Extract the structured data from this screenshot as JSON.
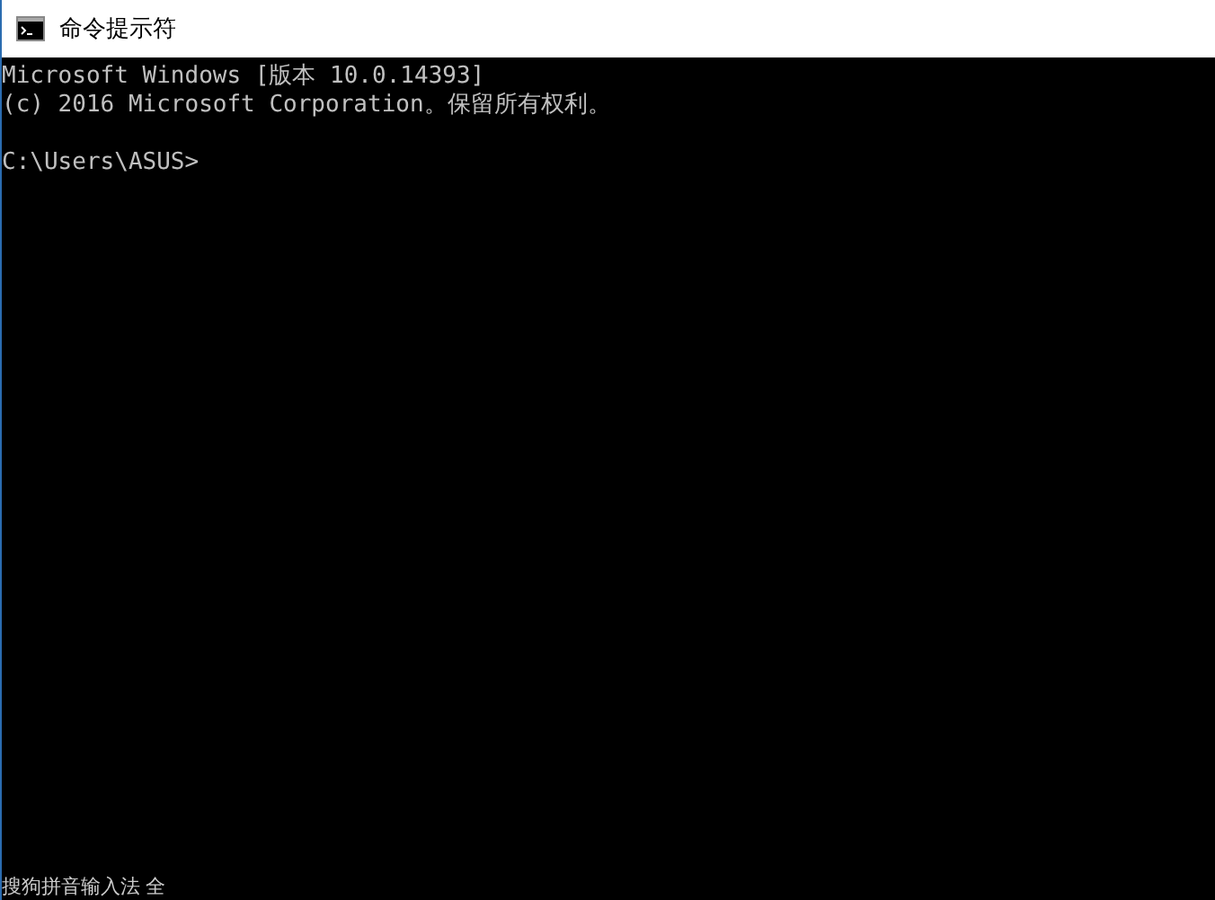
{
  "window": {
    "title": "命令提示符"
  },
  "console": {
    "banner": [
      "Microsoft Windows [版本 10.0.14393]",
      "(c) 2016 Microsoft Corporation。保留所有权利。"
    ],
    "prompt": "C:\\Users\\ASUS>"
  },
  "ime_bar": {
    "text": "搜狗拼音输入法 全"
  }
}
